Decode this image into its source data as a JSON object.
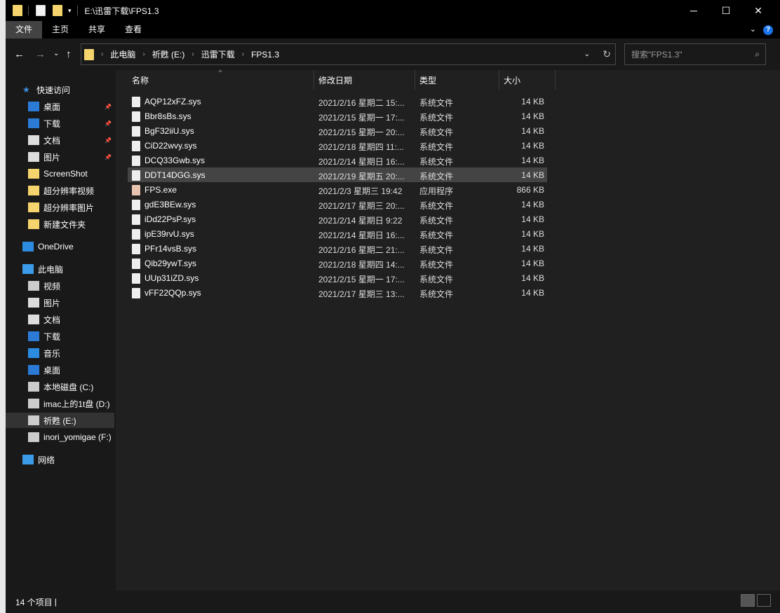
{
  "window": {
    "title": "E:\\迅雷下载\\FPS1.3",
    "minimize": "─",
    "maximize": "☐",
    "close": "✕"
  },
  "ribbon": {
    "tabs": [
      "文件",
      "主页",
      "共享",
      "查看"
    ],
    "help": "?",
    "expand": "⌄"
  },
  "nav": {
    "back": "←",
    "forward": "→",
    "recent": "⌄",
    "up": "↑",
    "refresh": "↻",
    "dropdown": "⌄"
  },
  "breadcrumb": [
    "此电脑",
    "祈甦 (E:)",
    "迅雷下载",
    "FPS1.3"
  ],
  "search": {
    "placeholder": "搜索\"FPS1.3\""
  },
  "sidebar": [
    {
      "label": "快速访问",
      "icon": "star-icon",
      "color": "#3c8fe0"
    },
    {
      "label": "桌面",
      "icon": "desktop-icon",
      "color": "#2b7bd6",
      "pinned": true
    },
    {
      "label": "下载",
      "icon": "download-icon",
      "color": "#2b7bd6",
      "pinned": true
    },
    {
      "label": "文档",
      "icon": "document-icon",
      "color": "#ddd",
      "pinned": true
    },
    {
      "label": "图片",
      "icon": "pictures-icon",
      "color": "#ddd",
      "pinned": true
    },
    {
      "label": "ScreenShot",
      "icon": "folder-icon",
      "color": "#f5d46e"
    },
    {
      "label": "超分辨率视频",
      "icon": "folder-icon",
      "color": "#f5d46e"
    },
    {
      "label": "超分辨率图片",
      "icon": "folder-icon",
      "color": "#f5d46e"
    },
    {
      "label": "新建文件夹",
      "icon": "folder-icon",
      "color": "#f5d46e"
    },
    {
      "label": "OneDrive",
      "icon": "cloud-icon",
      "color": "#2b8be0"
    },
    {
      "label": "此电脑",
      "icon": "computer-icon",
      "color": "#3c9be8"
    },
    {
      "label": "视频",
      "icon": "video-icon",
      "color": "#ccc"
    },
    {
      "label": "图片",
      "icon": "pictures-icon",
      "color": "#ddd"
    },
    {
      "label": "文档",
      "icon": "document-icon",
      "color": "#ddd"
    },
    {
      "label": "下载",
      "icon": "download-icon",
      "color": "#2b7bd6"
    },
    {
      "label": "音乐",
      "icon": "music-icon",
      "color": "#2b8be0"
    },
    {
      "label": "桌面",
      "icon": "desktop-icon",
      "color": "#2b7bd6"
    },
    {
      "label": "本地磁盘 (C:)",
      "icon": "drive-icon",
      "color": "#ccc"
    },
    {
      "label": "imac上的1t盘 (D:)",
      "icon": "drive-icon",
      "color": "#ccc"
    },
    {
      "label": "祈甦 (E:)",
      "icon": "drive-icon",
      "color": "#ccc",
      "selected": true
    },
    {
      "label": "inori_yomigae (F:)",
      "icon": "drive-icon",
      "color": "#ccc"
    },
    {
      "label": "网络",
      "icon": "network-icon",
      "color": "#3c9be8"
    }
  ],
  "columns": {
    "name": "名称",
    "date": "修改日期",
    "type": "类型",
    "size": "大小"
  },
  "files": [
    {
      "name": "AQP12xFZ.sys",
      "date": "2021/2/16 星期二 15:...",
      "type": "系统文件",
      "size": "14 KB"
    },
    {
      "name": "Bbr8sBs.sys",
      "date": "2021/2/15 星期一 17:...",
      "type": "系统文件",
      "size": "14 KB"
    },
    {
      "name": "BgF32iiU.sys",
      "date": "2021/2/15 星期一 20:...",
      "type": "系统文件",
      "size": "14 KB"
    },
    {
      "name": "CiD22wvy.sys",
      "date": "2021/2/18 星期四 11:...",
      "type": "系统文件",
      "size": "14 KB"
    },
    {
      "name": "DCQ33Gwb.sys",
      "date": "2021/2/14 星期日 16:...",
      "type": "系统文件",
      "size": "14 KB"
    },
    {
      "name": "DDT14DGG.sys",
      "date": "2021/2/19 星期五 20:...",
      "type": "系统文件",
      "size": "14 KB",
      "selected": true
    },
    {
      "name": "FPS.exe",
      "date": "2021/2/3 星期三 19:42",
      "type": "应用程序",
      "size": "866 KB",
      "exe": true
    },
    {
      "name": "gdE3BEw.sys",
      "date": "2021/2/17 星期三 20:...",
      "type": "系统文件",
      "size": "14 KB"
    },
    {
      "name": "iDd22PsP.sys",
      "date": "2021/2/14 星期日 9:22",
      "type": "系统文件",
      "size": "14 KB"
    },
    {
      "name": "ipE39rvU.sys",
      "date": "2021/2/14 星期日 16:...",
      "type": "系统文件",
      "size": "14 KB"
    },
    {
      "name": "PFr14vsB.sys",
      "date": "2021/2/16 星期二 21:...",
      "type": "系统文件",
      "size": "14 KB"
    },
    {
      "name": "Qib29ywT.sys",
      "date": "2021/2/18 星期四 14:...",
      "type": "系统文件",
      "size": "14 KB"
    },
    {
      "name": "UUp31iZD.sys",
      "date": "2021/2/15 星期一 17:...",
      "type": "系统文件",
      "size": "14 KB"
    },
    {
      "name": "vFF22QQp.sys",
      "date": "2021/2/17 星期三 13:...",
      "type": "系统文件",
      "size": "14 KB"
    }
  ],
  "status": {
    "count": "14 个项目"
  }
}
